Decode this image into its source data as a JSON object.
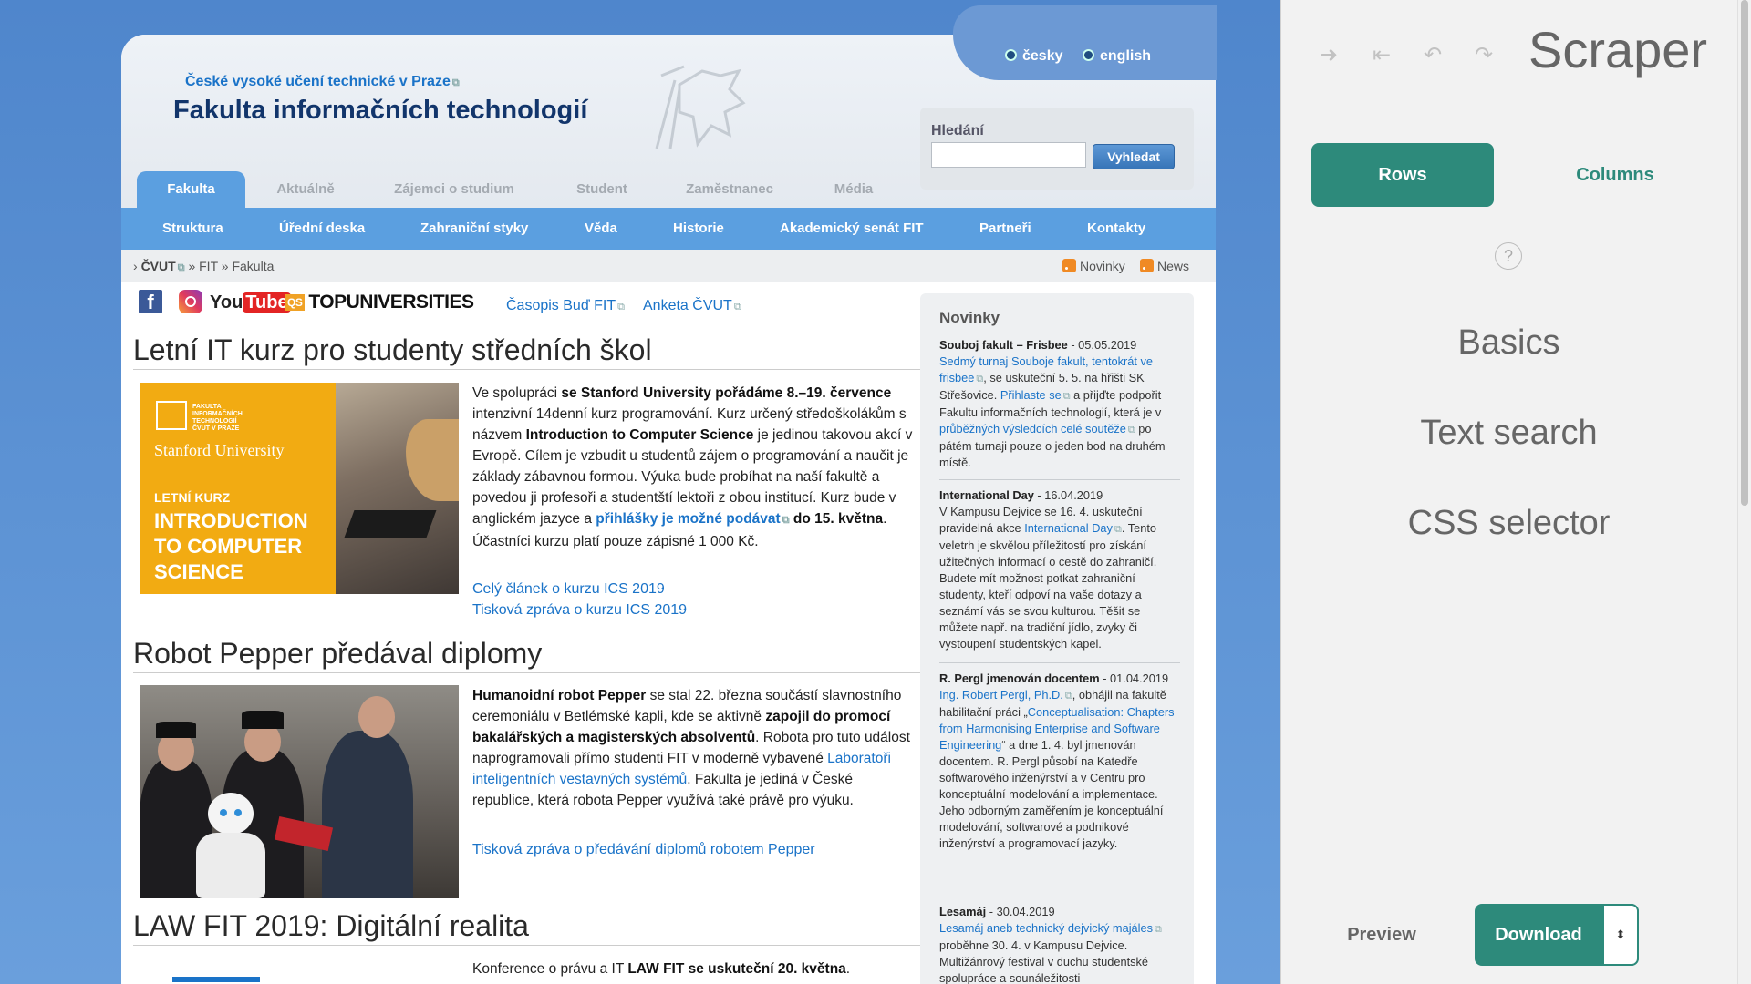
{
  "site": {
    "university_link": "České vysoké učení technické v Praze",
    "faculty_title": "Fakulta informačních technologií",
    "languages": [
      "česky",
      "english"
    ],
    "search": {
      "label": "Hledání",
      "placeholder": "",
      "button": "Vyhledat"
    },
    "main_tabs": [
      "Fakulta",
      "Aktuálně",
      "Zájemci o studium",
      "Student",
      "Zaměstnanec",
      "Média"
    ],
    "sub_nav": [
      "Struktura",
      "Úřední deska",
      "Zahraniční styky",
      "Věda",
      "Historie",
      "Akademický senát FIT",
      "Partneři",
      "Kontakty"
    ],
    "breadcrumb": {
      "root": "ČVUT",
      "mid": "FIT",
      "current": "Fakulta",
      "sep": "»"
    },
    "rss": [
      "Novinky",
      "News"
    ],
    "social": {
      "facebook": "f",
      "youtube_a": "You",
      "youtube_b": "Tube",
      "topuni_badge": "QS",
      "topuni": "TOPUNIVERSITIES"
    },
    "top_links": [
      "Časopis Buď FIT",
      "Anketa ČVUT"
    ]
  },
  "articles": {
    "a1": {
      "title": "Letní IT kurz pro studenty středních škol",
      "image": {
        "faculty_small": "FAKULTA\nINFORMAČNÍCH\nTECHNOLOGIÍ\nČVUT V PRAZE",
        "university": "Stanford University",
        "kurz": "LETNÍ KURZ",
        "big": "INTRODUCTION\nTO COMPUTER\nSCIENCE"
      },
      "t1": "Ve spolupráci ",
      "b1": "se Stanford University pořádáme 8.–19. července",
      "t2": " intenzivní 14denní kurz programování. Kurz určený středoškolákům s názvem ",
      "b2": "Introduction to Computer Science",
      "t3": " je jedinou takovou akcí v Evropě. Cílem je vzbudit u studentů zájem o programování a naučit je základy zábavnou formou. Výuka bude probíhat na naší fakultě a povedou ji profesoři a studentští lektoři z obou institucí. Kurz bude v anglickém jazyce a ",
      "l1": "přihlášky je možné podávat",
      "b3": " do 15. května",
      "t4": ". Účastníci kurzu platí pouze zápisné 1 000 Kč.",
      "link1": "Celý článek o kurzu ICS 2019",
      "link2": "Tisková zpráva o kurzu ICS 2019"
    },
    "a2": {
      "title": "Robot Pepper předával diplomy",
      "b1": "Humanoidní robot Pepper",
      "t1": " se stal 22. března součástí slavnostního ceremoniálu v Betlémské kapli, kde se aktivně ",
      "b2": "zapojil do promocí bakalářských a magisterských absolventů",
      "t2": ". Robota pro tuto událost naprogramovali přímo studenti FIT v moderně vybavené ",
      "l1": "Laboratoři inteligentních vestavných systémů",
      "t3": ". Fakulta je jediná v České republice, která robota Pepper využívá také právě pro výuku.",
      "link1": "Tisková zpráva o předávání diplomů robotem Pepper"
    },
    "a3": {
      "title": "LAW FIT 2019: Digitální realita",
      "t1": "Konference o právu a IT ",
      "b1": "LAW FIT se uskuteční 20. května",
      "t2": "."
    }
  },
  "news": {
    "title": "Novinky",
    "n1": {
      "title": "Souboj fakult – Frisbee",
      "date": " - 05.05.2019",
      "l1": "Sedmý turnaj Souboje fakult, tentokrát ve frisbee",
      "t1": ", se uskuteční 5. 5. na hřišti SK Střešovice. ",
      "l2": "Přihlaste se",
      "t2": " a přijďte podpořit Fakultu informačních technologií, která je v ",
      "l3": "průběžných výsledcích celé soutěže",
      "t3": " po pátém turnaji pouze o jeden bod na druhém místě."
    },
    "n2": {
      "title": "International Day",
      "date": " - 16.04.2019",
      "t1": "V Kampusu Dejvice se 16. 4. uskuteční pravidelná akce ",
      "l1": "International Day",
      "t2": ". Tento veletrh je skvělou příležitostí pro získání užitečných informací o cestě do zahraničí. Budete mít možnost potkat zahraniční studenty, kteří odpoví na vaše dotazy a seznámí vás se svou kulturou. Těšit se můžete např. na tradiční jídlo, zvyky či vystoupení studentských kapel."
    },
    "n3": {
      "title": "R. Pergl jmenován docentem",
      "date": " - 01.04.2019",
      "l1": "Ing. Robert Pergl, Ph.D.",
      "t1": ", obhájil na fakultě habilitační práci „",
      "l2": "Conceptualisation: Chapters from Harmonising Enterprise and Software Engineering",
      "t2": "“ a dne 1. 4. byl jmenován docentem. R. Pergl působí na Katedře softwarového inženýrství a v Centru pro konceptuální modelování a implementace. Jeho odborným zaměřením je konceptuální modelování, softwarové a podnikové inženýrství a programovací jazyky."
    },
    "n4": {
      "title": "Lesamáj",
      "date": " - 30.04.2019",
      "l1": "Lesamáj aneb technický dejvický majáles",
      "t1": " proběhne 30. 4. v Kampusu Dejvice. Multižánrový festival v duchu studentské spolupráce a sounáležitosti"
    }
  },
  "scraper": {
    "title": "Scraper",
    "toolbar_icons": [
      "arrow-right-icon",
      "collapse-left-icon",
      "undo-icon",
      "redo-icon"
    ],
    "rows": "Rows",
    "columns": "Columns",
    "help": "?",
    "menu": [
      "Basics",
      "Text search",
      "CSS selector"
    ],
    "preview": "Preview",
    "download": "Download",
    "download_arrow": "⬍"
  },
  "colors": {
    "accent": "#2d8a7b",
    "nav_blue": "#5b9fe0",
    "link": "#1a73c8",
    "title_navy": "#12356b"
  }
}
